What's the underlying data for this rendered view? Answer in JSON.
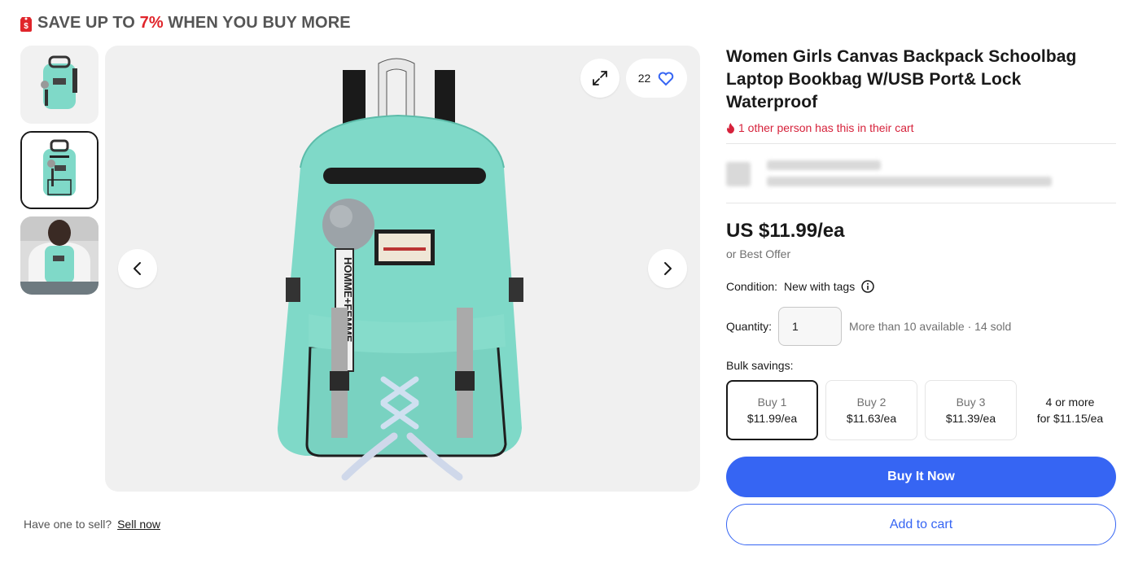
{
  "promo": {
    "prefix": "SAVE UP TO ",
    "percent": "7%",
    "suffix": " WHEN YOU BUY MORE",
    "accent": "#e0252b"
  },
  "gallery": {
    "thumbnails": [
      "backpack-front-thumbnail",
      "backpack-selected-thumbnail",
      "model-wearing-backpack-thumbnail"
    ],
    "selected_index": 1,
    "watch_count": "22"
  },
  "sell": {
    "prompt": "Have one to sell?",
    "link": "Sell now"
  },
  "product": {
    "title": "Women Girls Canvas Backpack Schoolbag Laptop Bookbag W/USB Port& Lock Waterproof",
    "cart_note": "1 other person has this in their cart",
    "price": "US $11.99/ea",
    "best_offer": "or Best Offer",
    "condition_label": "Condition:",
    "condition_value": "New with tags",
    "quantity_label": "Quantity:",
    "quantity_value": "1",
    "availability": "More than 10 available · 14 sold",
    "bulk_label": "Bulk savings:",
    "bulk": [
      {
        "qty": "Buy 1",
        "price": "$11.99/ea",
        "selected": true
      },
      {
        "qty": "Buy 2",
        "price": "$11.63/ea"
      },
      {
        "qty": "Buy 3",
        "price": "$11.39/ea"
      }
    ],
    "bulk_more": {
      "qty": "4 or more",
      "price": "for $11.15/ea"
    },
    "buy_now": "Buy It Now",
    "add_to_cart": "Add to cart"
  },
  "colors": {
    "primary": "#3665f3",
    "alert": "#d6223b",
    "backpack": "#7fd9c8"
  }
}
